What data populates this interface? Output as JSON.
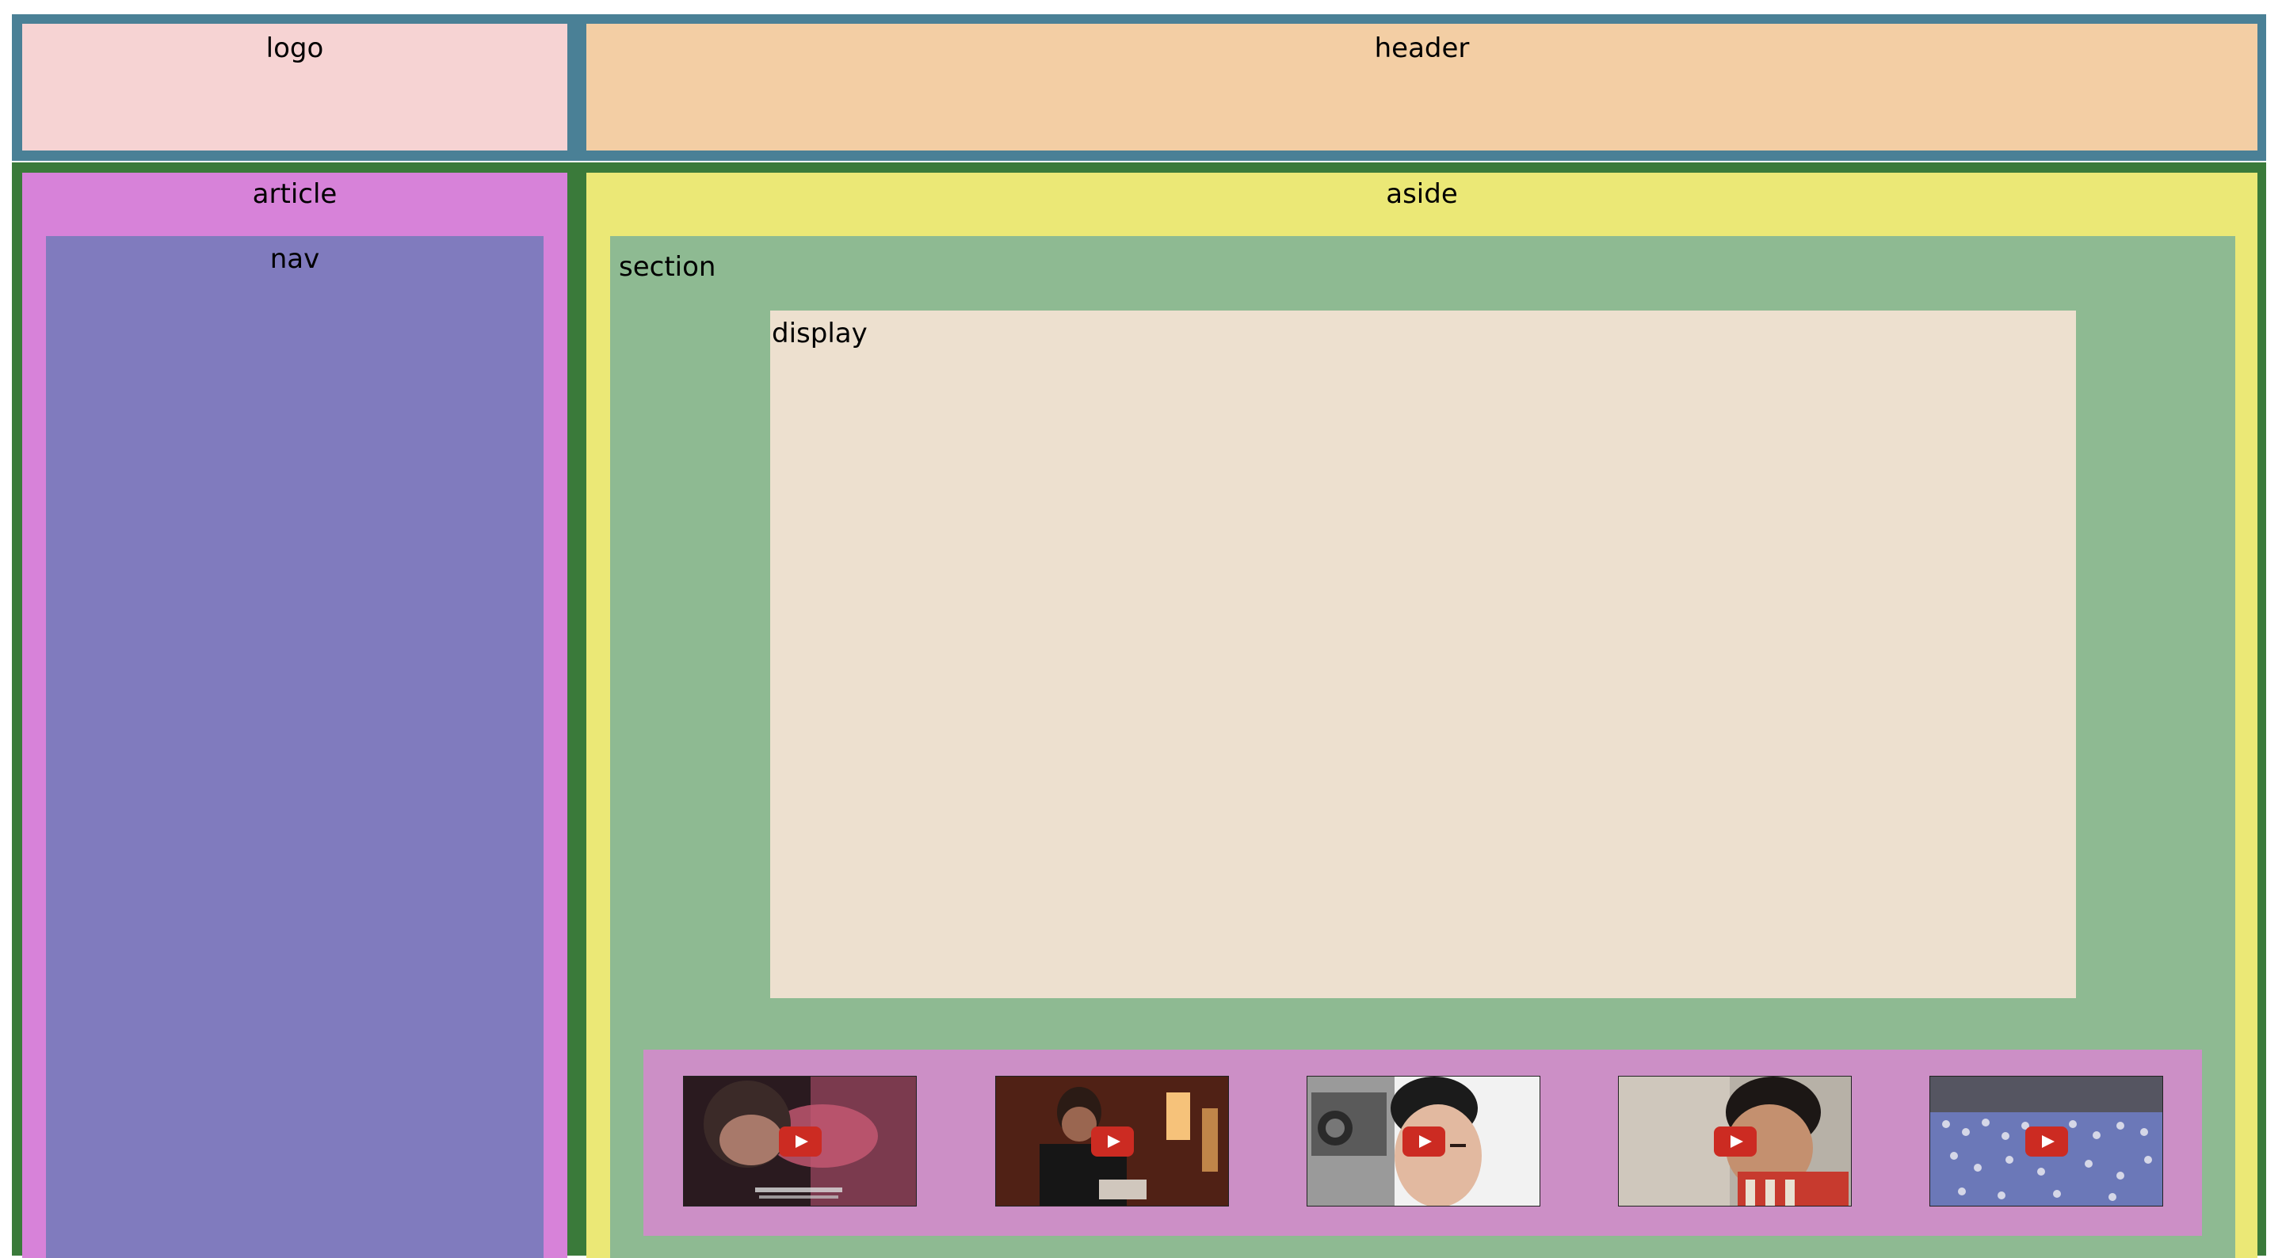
{
  "header_band": {
    "logo_label": "logo",
    "header_label": "header"
  },
  "main": {
    "article_label": "article",
    "nav_label": "nav",
    "aside_label": "aside",
    "section_label": "section",
    "display_label": "display"
  },
  "thumbnails": [
    {
      "name": "video-thumbnail-1",
      "icon": "play-button-icon"
    },
    {
      "name": "video-thumbnail-2",
      "icon": "play-button-icon"
    },
    {
      "name": "video-thumbnail-3",
      "icon": "play-button-icon"
    },
    {
      "name": "video-thumbnail-4",
      "icon": "play-button-icon"
    },
    {
      "name": "video-thumbnail-5",
      "icon": "play-button-icon"
    }
  ],
  "colors": {
    "header_band": "#4a8096",
    "logo": "#f6d3d3",
    "header": "#f3cea4",
    "main_band": "#3a7a3a",
    "article": "#d782d9",
    "nav": "#807bbe",
    "aside": "#ebe876",
    "section": "#8eba92",
    "display": "#ede0cf",
    "thumbnail_strip": "#cc8fc6",
    "play_button": "#cc2b22"
  }
}
